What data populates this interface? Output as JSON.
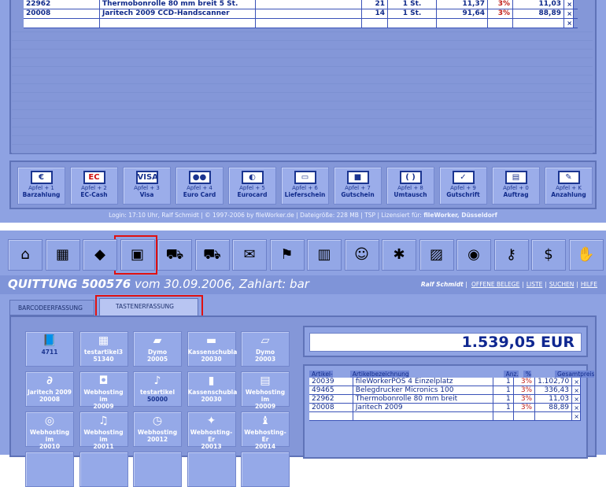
{
  "top_table": {
    "rows": [
      {
        "nr": "22962",
        "name": "Thermobonrolle 80 mm breit 5 St.",
        "stock": "21",
        "unit": "1 St.",
        "price": "11,37",
        "pct": "3%",
        "total": "11,03"
      },
      {
        "nr": "20008",
        "name": "Jaritech 2009 CCD-Handscanner",
        "stock": "14",
        "unit": "1 St.",
        "price": "91,64",
        "pct": "3%",
        "total": "88,89"
      }
    ]
  },
  "payment_buttons": [
    {
      "shortcut": "Apfel + 1",
      "label": "Barzahlung",
      "icon": "banknote-icon",
      "glyph": "€"
    },
    {
      "shortcut": "Apfel + 2",
      "label": "EC-Cash",
      "icon": "ec-card-icon",
      "glyph": "EC"
    },
    {
      "shortcut": "Apfel + 3",
      "label": "Visa",
      "icon": "visa-card-icon",
      "glyph": "VISA"
    },
    {
      "shortcut": "Apfel + 4",
      "label": "Euro Card",
      "icon": "mastercard-icon",
      "glyph": "●●"
    },
    {
      "shortcut": "Apfel + 5",
      "label": "Eurocard",
      "icon": "diners-card-icon",
      "glyph": "◐"
    },
    {
      "shortcut": "Apfel + 6",
      "label": "Lieferschein",
      "icon": "folder-icon",
      "glyph": "▭"
    },
    {
      "shortcut": "Apfel + 7",
      "label": "Gutschein",
      "icon": "gift-icon",
      "glyph": "■"
    },
    {
      "shortcut": "Apfel + 8",
      "label": "Umtausch",
      "icon": "exchange-icon",
      "glyph": "( )"
    },
    {
      "shortcut": "Apfel + 9",
      "label": "Gutschrift",
      "icon": "checkmark-icon",
      "glyph": "✓"
    },
    {
      "shortcut": "Apfel + 0",
      "label": "Auftrag",
      "icon": "document-icon",
      "glyph": "▤"
    },
    {
      "shortcut": "Apfel + K",
      "label": "Anzahlung",
      "icon": "signature-icon",
      "glyph": "✎"
    }
  ],
  "status": {
    "login": "Login: 17:10 Uhr, Ralf Schmidt",
    "copyright": "© 1997-2006 by fileWorker.de",
    "filesize": "Dateigröße: 228 MB",
    "tsp": "TSP",
    "license_label": "Lizensiert für:",
    "license": "fileWorker, Düsseldorf"
  },
  "toolbar": [
    {
      "icon": "home-icon",
      "glyph": "⌂"
    },
    {
      "icon": "contacts-icon",
      "glyph": "▦"
    },
    {
      "icon": "book-icon",
      "glyph": "◆"
    },
    {
      "icon": "cash-register-icon",
      "glyph": "▣"
    },
    {
      "icon": "shopping-cart-icon",
      "glyph": "⛟"
    },
    {
      "icon": "truck-icon",
      "glyph": "⛟"
    },
    {
      "icon": "mail-write-icon",
      "glyph": "✉"
    },
    {
      "icon": "mailbox-icon",
      "glyph": "⚑"
    },
    {
      "icon": "inbox-icon",
      "glyph": "▥"
    },
    {
      "icon": "user-icon",
      "glyph": "☺"
    },
    {
      "icon": "report-icon",
      "glyph": "✱"
    },
    {
      "icon": "chart-icon",
      "glyph": "▨"
    },
    {
      "icon": "network-icon",
      "glyph": "◉"
    },
    {
      "icon": "keys-icon",
      "glyph": "⚷"
    },
    {
      "icon": "money-icon",
      "glyph": "$"
    },
    {
      "icon": "hand-money-icon",
      "glyph": "✋"
    }
  ],
  "header": {
    "title_bold": "QUITTUNG 500576",
    "title_rest": " vom 30.09.2006, Zahlart: bar",
    "user": "Ralf Schmidt",
    "links": [
      "OFFENE BELEGE",
      "LISTE",
      "SUCHEN",
      "HILFE"
    ]
  },
  "tabs": [
    {
      "label": "BARCODEERFASSUNG"
    },
    {
      "label": "TASTENERFASSUNG"
    }
  ],
  "keys": [
    {
      "name": "",
      "code": "4711",
      "icon": "book-icon",
      "glyph": "📘"
    },
    {
      "name": "testartikel3",
      "code": "51340",
      "icon": "calculator-icon",
      "glyph": "▦"
    },
    {
      "name": "Dymo",
      "code": "20005",
      "icon": "gold-icon",
      "glyph": "▰"
    },
    {
      "name": "Kassenschubla",
      "code": "20030",
      "icon": "drawer-icon",
      "glyph": "▬"
    },
    {
      "name": "Dymo",
      "code": "20003",
      "icon": "printer-icon",
      "glyph": "▱"
    },
    {
      "name": "Jaritech 2009",
      "code": "20008",
      "icon": "carabiner-icon",
      "glyph": "∂"
    },
    {
      "name": "Webhosting im",
      "code": "20009",
      "icon": "camera-icon",
      "glyph": "◘"
    },
    {
      "name": "testartikel",
      "code": "50000",
      "icon": "sock-icon",
      "glyph": "♪"
    },
    {
      "name": "Kassenschubla",
      "code": "20030",
      "icon": "bottle-icon",
      "glyph": "▮"
    },
    {
      "name": "Webhosting im",
      "code": "20009",
      "icon": "books-icon",
      "glyph": "▤"
    },
    {
      "name": "Webhosting im",
      "code": "20010",
      "icon": "cd-icon",
      "glyph": "◎"
    },
    {
      "name": "Webhosting im",
      "code": "20011",
      "icon": "music-icon",
      "glyph": "♫"
    },
    {
      "name": "Webhosting",
      "code": "20012",
      "icon": "clock-icon",
      "glyph": "◷"
    },
    {
      "name": "Webhosting-Er",
      "code": "20013",
      "icon": "compass-icon",
      "glyph": "✦"
    },
    {
      "name": "Webhosting-Er",
      "code": "20014",
      "icon": "trophy-icon",
      "glyph": "♝"
    }
  ],
  "total": "1.539,05 EUR",
  "receipt": {
    "headers": [
      "Artikel-Nr.",
      "Artikelbezeichnung",
      "Anz.",
      "%",
      "Gesamtpreis"
    ],
    "rows": [
      {
        "nr": "20039",
        "name": "fileWorkerPOS 4 Einzelplatz",
        "qty": "1",
        "pct": "3%",
        "total": "1.102,70"
      },
      {
        "nr": "49465",
        "name": "Belegdrucker Micronics 100",
        "qty": "1",
        "pct": "3%",
        "total": "336,43"
      },
      {
        "nr": "22962",
        "name": "Thermobonrolle 80 mm breit",
        "qty": "1",
        "pct": "3%",
        "total": "11,03"
      },
      {
        "nr": "20008",
        "name": "Jaritech 2009",
        "qty": "1",
        "pct": "3%",
        "total": "88,89"
      }
    ]
  }
}
